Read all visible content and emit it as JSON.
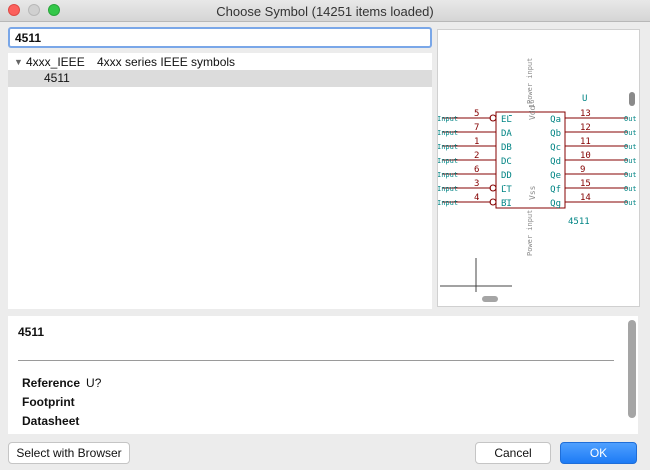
{
  "window": {
    "title": "Choose Symbol (14251 items loaded)"
  },
  "search": {
    "value": "4511"
  },
  "tree": {
    "library": {
      "name": "4xxx_IEEE",
      "description": "4xxx series IEEE symbols"
    },
    "selected_item": "4511"
  },
  "preview": {
    "reference": "U",
    "value": "4511",
    "left_pins": [
      {
        "num": "5",
        "name": "EL",
        "inverted": true
      },
      {
        "num": "7",
        "name": "DA",
        "inverted": false
      },
      {
        "num": "1",
        "name": "DB",
        "inverted": false
      },
      {
        "num": "2",
        "name": "DC",
        "inverted": false
      },
      {
        "num": "6",
        "name": "DD",
        "inverted": false
      },
      {
        "num": "3",
        "name": "LT",
        "inverted": true
      },
      {
        "num": "4",
        "name": "BI",
        "inverted": true
      }
    ],
    "right_pins": [
      {
        "num": "13",
        "name": "Qa"
      },
      {
        "num": "12",
        "name": "Qb"
      },
      {
        "num": "11",
        "name": "Qc"
      },
      {
        "num": "10",
        "name": "Qd"
      },
      {
        "num": "9",
        "name": "Qe"
      },
      {
        "num": "15",
        "name": "Qf"
      },
      {
        "num": "14",
        "name": "Qg"
      }
    ],
    "input_label": "Input",
    "output_label": "Out",
    "vdd_label": "Vdd",
    "vdd_type": "Power input",
    "vdd_pin": "16",
    "vss_label": "Vss",
    "vss_type": "Power input",
    "colors": {
      "body": "#840000",
      "text": "#008484",
      "pin_type": "#8c8c8c"
    }
  },
  "details": {
    "symbol_name": "4511",
    "reference_label": "Reference",
    "reference_value": "U?",
    "footprint_label": "Footprint",
    "datasheet_label": "Datasheet"
  },
  "buttons": {
    "browse": "Select with Browser",
    "cancel": "Cancel",
    "ok": "OK"
  }
}
